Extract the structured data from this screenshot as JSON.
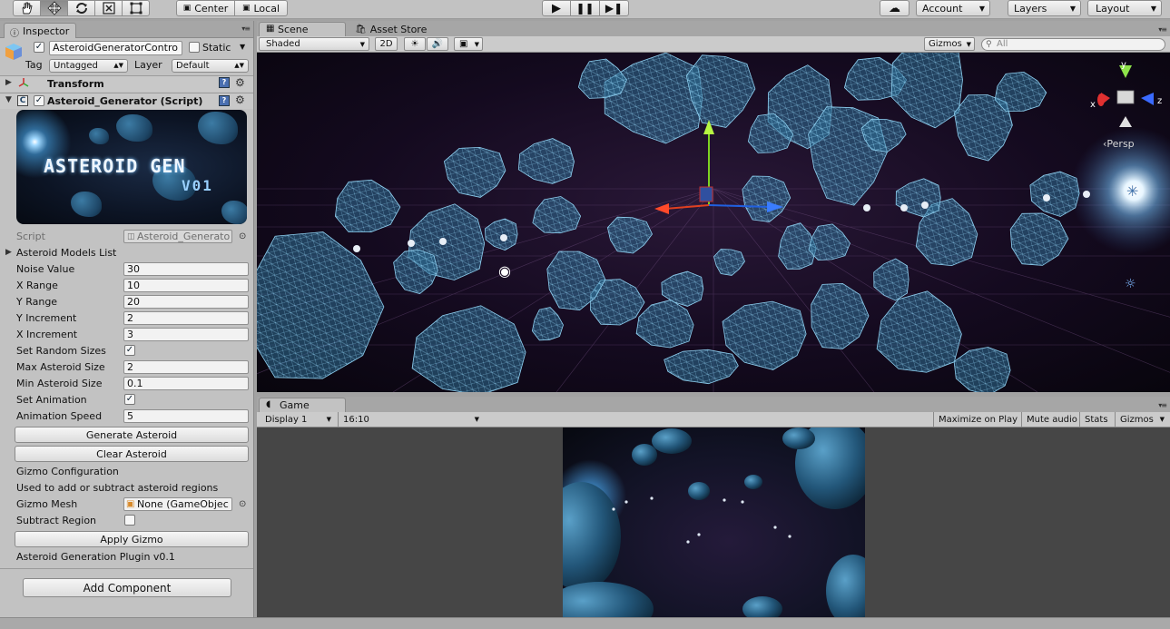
{
  "toolbar": {
    "tools": [
      "hand-tool",
      "move-tool",
      "rotate-tool",
      "scale-tool",
      "rect-tool"
    ],
    "pivot_label": "Center",
    "space_label": "Local",
    "account_label": "Account",
    "layers_label": "Layers",
    "layout_label": "Layout"
  },
  "inspector": {
    "tab_label": "Inspector",
    "object_name": "AsteroidGeneratorContro",
    "static_label": "Static",
    "tag_label": "Tag",
    "tag_value": "Untagged",
    "layer_label": "Layer",
    "layer_value": "Default",
    "transform_label": "Transform",
    "script_component_label": "Asteroid_Generator (Script)",
    "banner_title": "ASTEROID GEN",
    "banner_version": "V01",
    "script_label": "Script",
    "script_value": "Asteroid_Generato",
    "models_list_label": "Asteroid Models List",
    "fields": [
      {
        "label": "Noise Value",
        "value": "30"
      },
      {
        "label": "X Range",
        "value": "10"
      },
      {
        "label": "Y Range",
        "value": "20"
      },
      {
        "label": "Y Increment",
        "value": "2"
      },
      {
        "label": "X Increment",
        "value": "3"
      }
    ],
    "set_random_sizes_label": "Set Random Sizes",
    "set_random_sizes_checked": true,
    "max_size_label": "Max Asteroid Size",
    "max_size_value": "2",
    "min_size_label": "Min Asteroid Size",
    "min_size_value": "0.1",
    "set_animation_label": "Set Animation",
    "set_animation_checked": true,
    "animation_speed_label": "Animation Speed",
    "animation_speed_value": "5",
    "generate_button": "Generate Asteroid",
    "clear_button": "Clear Asteroid",
    "gizmo_config_label": "Gizmo Configuration",
    "gizmo_help": "Used to add or subtract asteroid regions",
    "gizmo_mesh_label": "Gizmo Mesh",
    "gizmo_mesh_value": "None (GameObjec",
    "subtract_region_label": "Subtract Region",
    "subtract_region_checked": false,
    "apply_gizmo_button": "Apply Gizmo",
    "plugin_version": "Asteroid Generation Plugin v0.1",
    "add_component_button": "Add Component"
  },
  "scene": {
    "tab_label": "Scene",
    "asset_store_tab_label": "Asset Store",
    "shading_mode": "Shaded",
    "mode_2d": "2D",
    "gizmos_label": "Gizmos",
    "search_placeholder": "All",
    "axis_x": "x",
    "axis_y": "y",
    "axis_z": "z",
    "persp_label": "Persp"
  },
  "game": {
    "tab_label": "Game",
    "display": "Display 1",
    "aspect": "16:10",
    "maximize_label": "Maximize on Play",
    "mute_label": "Mute audio",
    "stats_label": "Stats",
    "gizmos_label": "Gizmos"
  }
}
